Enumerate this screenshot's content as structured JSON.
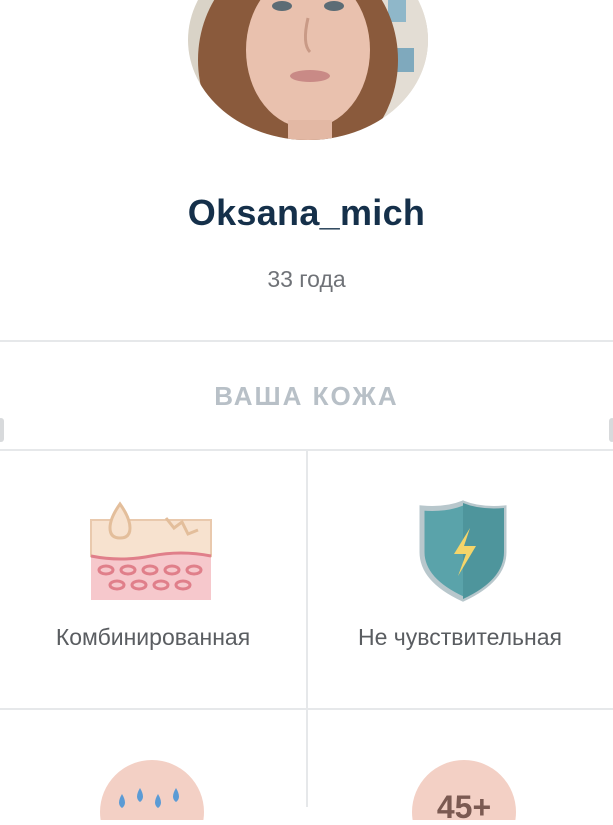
{
  "profile": {
    "username": "Oksana_mich",
    "age": "33 года"
  },
  "skin": {
    "section_title": "ВАША КОЖА",
    "tiles": [
      {
        "label": "Комбинированная",
        "icon": "combination-skin-icon"
      },
      {
        "label": "Не чувствительная",
        "icon": "shield-lightning-icon"
      },
      {
        "label": "",
        "icon": "water-drops-icon"
      },
      {
        "label": "",
        "icon": "age-badge-icon",
        "badge_text": "45+"
      }
    ]
  },
  "colors": {
    "username": "#15304a",
    "section_title": "#b8c0c7",
    "shield": "#5aa3aa",
    "accent_pink": "#f3c7ca",
    "accent_yellow": "#f5d56a"
  }
}
